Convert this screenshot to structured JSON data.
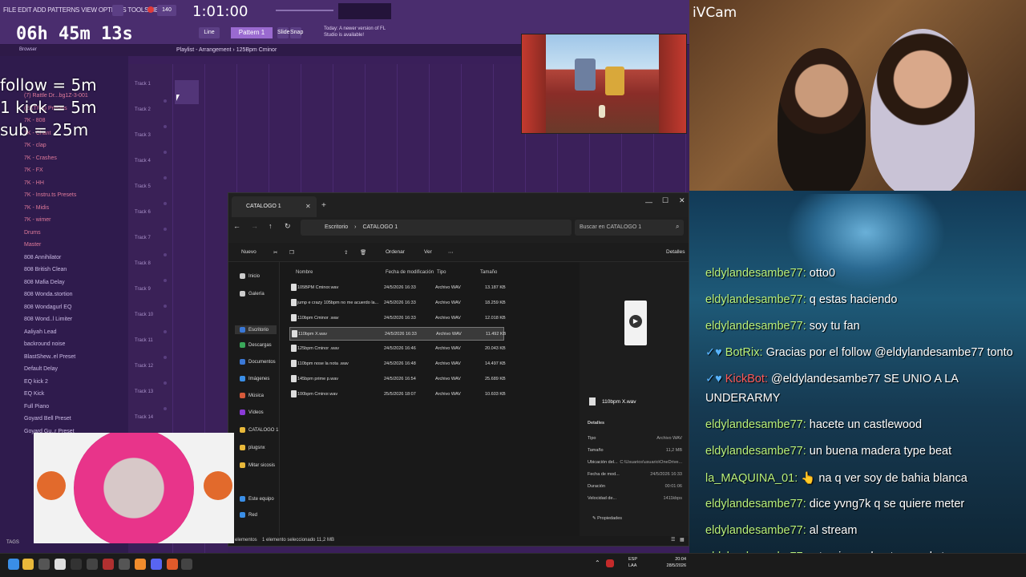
{
  "fl": {
    "menu": "FILE EDIT ADD PATTERNS VIEW OPTIONS TOOLS HELP",
    "song_time": "1:01:00",
    "bpm_label": "PAT SONG",
    "pattern": "Pattern 1",
    "tempo_tags": [
      "Slide",
      "Snap",
      "Line"
    ],
    "update_note": "Today: A newer version of FL Studio is available!",
    "playlist_title": "Playlist - Arrangement › 125Bpm Cminor",
    "browser_title": "Browser",
    "tracks": [
      "Track 1",
      "Track 2",
      "Track 3",
      "Track 4",
      "Track 5",
      "Track 6",
      "Track 7",
      "Track 8",
      "Track 9",
      "Track 10",
      "Track 11",
      "Track 12",
      "Track 13",
      "Track 14"
    ],
    "browser_items": [
      "(7) Rattle Dr...bg1Z-3-001",
      "(EXTRA) Presets",
      "7K - 808",
      "7K - Chant",
      "7K - clap",
      "7K - Crashes",
      "7K - FX",
      "7K - HH",
      "7K - Instru.ts Presets",
      "7K - Midis",
      "7K - wimer",
      "Drums",
      "Master",
      "808 Annihilator",
      "808 British Clean",
      "808 Mafia Delay",
      "808 Wonda.stortion",
      "808 Wondagurl EQ",
      "808 Wond..l Limiter",
      "Aaliyah Lead",
      "backround noise",
      "BlastShew..el Preset",
      "Default Delay",
      "EQ kick 2",
      "EQ Kick",
      "Full Piano",
      "Goyard Bell Preset",
      "Goyard Gu..r Preset"
    ],
    "tags": "TAGS"
  },
  "overlay": {
    "timer": "06h 45m 13s",
    "goals": [
      "follow = 5m",
      "1 kick = 5m",
      "sub = 25m"
    ]
  },
  "webcam": {
    "label": "iVCam"
  },
  "chat": [
    {
      "user": "eldylandesambe77:",
      "msg": "otto0",
      "color": "#b9f07a"
    },
    {
      "user": "eldylandesambe77:",
      "msg": "q estas haciendo",
      "color": "#b9f07a"
    },
    {
      "user": "eldylandesambe77:",
      "msg": "soy tu fan",
      "color": "#b9f07a"
    },
    {
      "user": "BotRix:",
      "msg": "Gracias por el follow @eldylandesambe77 tonto",
      "color": "#b9f07a"
    },
    {
      "user": "KickBot:",
      "msg": "@eldylandesambe77 SE UNIO A LA",
      "color": "#ff5a5a"
    },
    {
      "user": "",
      "msg": "UNDERARMY",
      "color": "#ffffff"
    },
    {
      "user": "eldylandesambe77:",
      "msg": "hacete un castlewood",
      "color": "#b9f07a"
    },
    {
      "user": "eldylandesambe77:",
      "msg": "un buena madera type beat",
      "color": "#b9f07a"
    },
    {
      "user": "la_MAQUINA_01:",
      "msg": "👆 na q ver soy de bahia blanca",
      "color": "#b9f07a"
    },
    {
      "user": "eldylandesambe77:",
      "msg": "dice yvng7k q se quiere meter",
      "color": "#b9f07a"
    },
    {
      "user": "eldylandesambe77:",
      "msg": "al stream",
      "color": "#b9f07a"
    },
    {
      "user": "eldylandesambe77:",
      "msg": "q te gira un beat para el stream",
      "color": "#b9f07a"
    }
  ],
  "explorer": {
    "tab_title": "CATALOGO 1",
    "breadcrumb": [
      "Escritorio",
      "CATALOGO 1"
    ],
    "search_placeholder": "Buscar en CATALOGO 1",
    "commands": [
      "Nuevo",
      "Ordenar",
      "Ver",
      "Detalles"
    ],
    "columns": [
      "Nombre",
      "Fecha de modificación",
      "Tipo",
      "Tamaño"
    ],
    "nav": [
      "Inicio",
      "Galería",
      "Escritorio",
      "Descargas",
      "Documentos",
      "Imágenes",
      "Música",
      "Vídeos",
      "CATALOGO 1",
      "plugsnx",
      "Mitar sicosis",
      "Este equipo",
      "Red"
    ],
    "files": [
      {
        "name": "105BPM Cminor.wav",
        "date": "24/5/2026 16:33",
        "type": "Archivo WAV",
        "size": "13.187 KB"
      },
      {
        "name": "jump e crazy 105bpm no me acuerdo la...",
        "date": "24/5/2026 16:33",
        "type": "Archivo WAV",
        "size": "18.259 KB"
      },
      {
        "name": "110bpm Cminor .wav",
        "date": "24/5/2026 16:33",
        "type": "Archivo WAV",
        "size": "12.018 KB"
      },
      {
        "name": "110bpm X.wav",
        "date": "24/5/2026 16:33",
        "type": "Archivo WAV",
        "size": "11.492 KB"
      },
      {
        "name": "125bpm Cminor .wav",
        "date": "24/5/2026 16:46",
        "type": "Archivo WAV",
        "size": "20.043 KB"
      },
      {
        "name": "110bpm nose la nota .wav",
        "date": "24/5/2026 16:48",
        "type": "Archivo WAV",
        "size": "14.497 KB"
      },
      {
        "name": "145bpm prime p.wav",
        "date": "24/5/2026 16:54",
        "type": "Archivo WAV",
        "size": "25.689 KB"
      },
      {
        "name": "100bpm Cminor.wav",
        "date": "25/5/2026 18:07",
        "type": "Archivo WAV",
        "size": "10.603 KB"
      }
    ],
    "selected_index": 3,
    "preview": {
      "filename": "110bpm X.wav",
      "section": "Detalles",
      "fields": [
        {
          "k": "Tipo",
          "v": "Archivo WAV"
        },
        {
          "k": "Tamaño",
          "v": "11,2 MB"
        },
        {
          "k": "Ubicación del...",
          "v": "C:\\Usuarios\\usuario\\OneDrive..."
        },
        {
          "k": "Fecha de mod...",
          "v": "24/5/2026 16:33"
        },
        {
          "k": "Duración",
          "v": "00:01:06"
        },
        {
          "k": "Velocidad de...",
          "v": "1411kbps"
        }
      ],
      "props": "Propiedades"
    },
    "status": "1 elemento seleccionado  11,2 MB",
    "status_left": "elementos"
  },
  "taskbar": {
    "lang": "ESP\nLAA",
    "time": "20:04",
    "date": "28/5/2026"
  }
}
